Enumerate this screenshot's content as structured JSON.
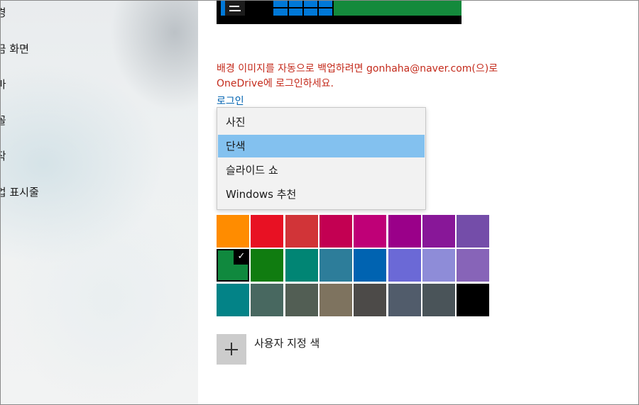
{
  "sidebar": {
    "items": [
      {
        "label": "배경",
        "icon": "picture-icon"
      },
      {
        "label": "잠금 화면",
        "icon": "lock-screen-icon"
      },
      {
        "label": "테마",
        "icon": "brush-icon"
      },
      {
        "label": "글꼴",
        "icon": "font-icon"
      },
      {
        "label": "시작",
        "icon": "start-icon"
      },
      {
        "label": "작업 표시줄",
        "icon": "taskbar-icon"
      }
    ]
  },
  "main": {
    "warning": "배경 이미지를 자동으로 백업하려면 gonhaha@naver.com(으)로 OneDrive에 로그인하세요.",
    "login_link": "로그인",
    "background_dropdown": {
      "options": [
        "사진",
        "단색",
        "슬라이드 쇼",
        "Windows 추천"
      ],
      "selected": "단색"
    },
    "colors": {
      "rows": [
        [
          "#ff8c00",
          "#e81123",
          "#d13438",
          "#c30052",
          "#bf0077",
          "#9a0089",
          "#881798",
          "#744da9"
        ],
        [
          "#10893e",
          "#107c10",
          "#018574",
          "#2d7d9a",
          "#0063b1",
          "#6b69d6",
          "#8e8cd8",
          "#8764b8"
        ],
        [
          "#038387",
          "#486860",
          "#525e54",
          "#7e735f",
          "#4c4a48",
          "#515c6b",
          "#4a5459",
          "#000000"
        ]
      ],
      "selected": "#10893e",
      "selected_mark": "✓"
    },
    "custom_color": {
      "label": "사용자 지정 색",
      "icon": "plus-icon"
    }
  },
  "accent": {
    "preview_accent": "#148a3c",
    "preview_tiles": "#0078d7",
    "warning_color": "#c42b1c",
    "link_color": "#0063b1",
    "selection_highlight": "#83c1ef"
  }
}
